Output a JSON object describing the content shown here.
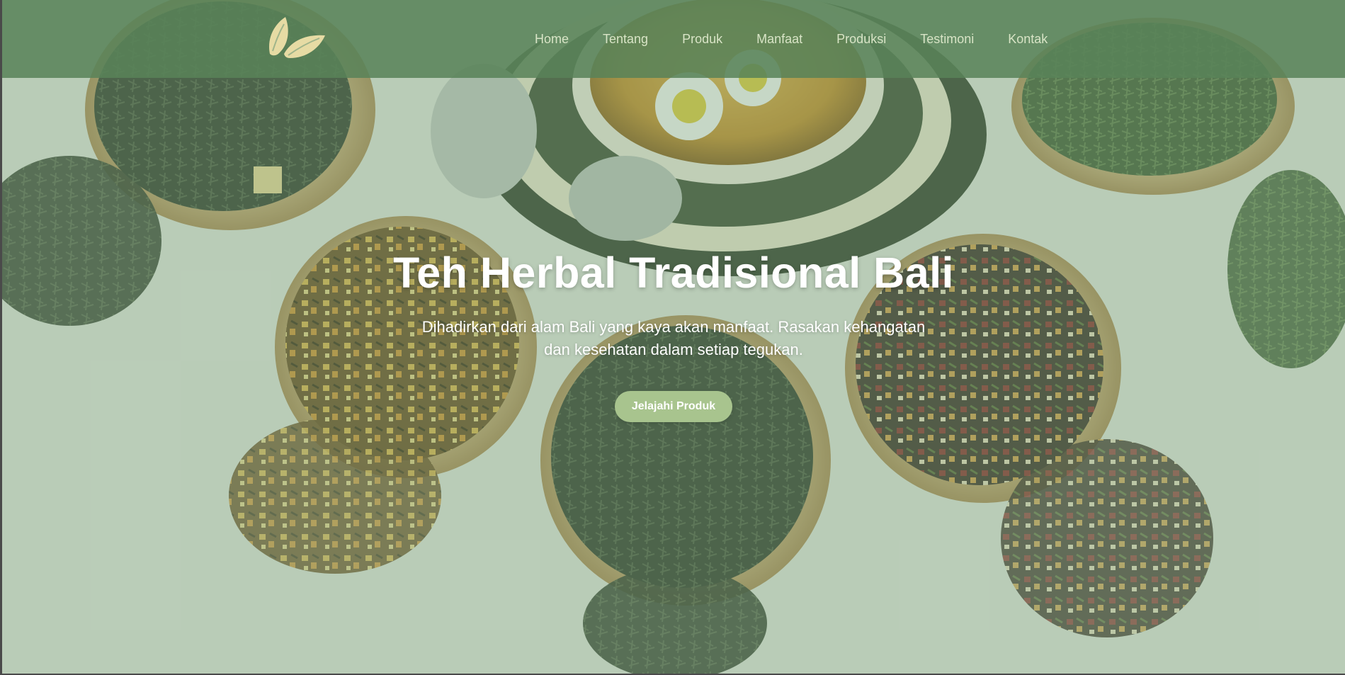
{
  "brand": {
    "logo_icon": "leaf-logo-icon",
    "logo_color": "#e6dba4"
  },
  "nav": {
    "items": [
      {
        "label": "Home"
      },
      {
        "label": "Tentang"
      },
      {
        "label": "Produk"
      },
      {
        "label": "Manfaat"
      },
      {
        "label": "Produksi"
      },
      {
        "label": "Testimoni"
      },
      {
        "label": "Kontak"
      }
    ]
  },
  "hero": {
    "title": "Teh Herbal Tradisional Bali",
    "subtitle": "Dihadirkan dari alam Bali yang kaya akan manfaat. Rasakan kehangatan dan kesehatan dalam setiap tegukan.",
    "cta_label": "Jelajahi Produk",
    "background_image": "herbal-tea-bowls-photo"
  },
  "colors": {
    "navbar": "#58825a",
    "overlay": "#78a078",
    "nav_text": "#d8e4c6",
    "button": "#a8c48e",
    "text": "#ffffff"
  }
}
